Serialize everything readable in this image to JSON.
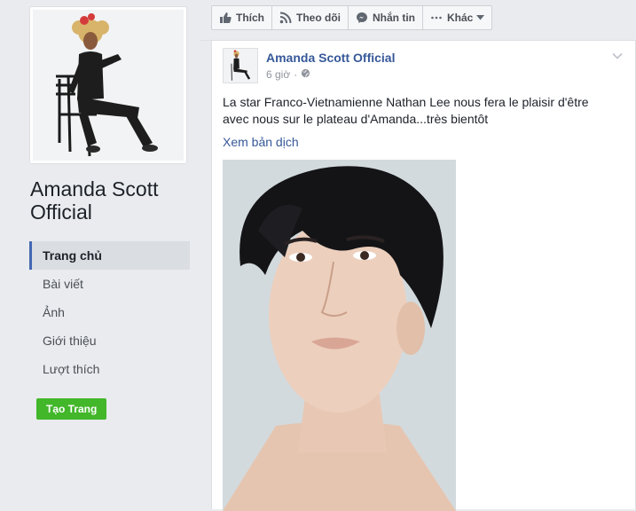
{
  "page": {
    "name": "Amanda Scott Official"
  },
  "nav": {
    "items": [
      {
        "label": "Trang chủ"
      },
      {
        "label": "Bài viết"
      },
      {
        "label": "Ảnh"
      },
      {
        "label": "Giới thiệu"
      },
      {
        "label": "Lượt thích"
      }
    ],
    "create_page": "Tạo Trang"
  },
  "actions": {
    "like": "Thích",
    "follow": "Theo dõi",
    "message": "Nhắn tin",
    "more": "Khác"
  },
  "post": {
    "author": "Amanda Scott Official",
    "time": "6 giờ",
    "text": "La star Franco-Vietnamienne Nathan Lee nous fera le plaisir d'être avec nous sur le plateau d'Amanda...très bientôt",
    "see_translation": "Xem bản dịch"
  },
  "colors": {
    "link": "#365899",
    "accent": "#4267b2",
    "create_button": "#42b72a",
    "background": "#e9ebee"
  },
  "icons": {
    "like": "thumbs-up-icon",
    "follow": "rss-icon",
    "message": "messenger-icon",
    "more": "ellipsis-icon",
    "privacy": "globe-icon",
    "menu": "chevron-down-icon"
  }
}
